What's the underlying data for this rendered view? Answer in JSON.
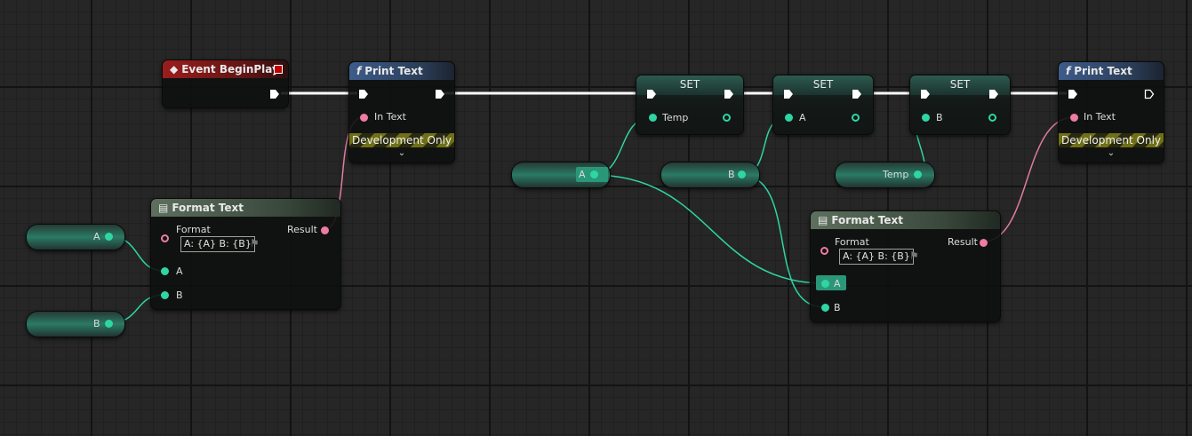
{
  "nodes": {
    "event_begin_play": {
      "title": "Event BeginPlay"
    },
    "print_text_1": {
      "title": "Print Text",
      "in_text_label": "In Text",
      "dev_only": "Development Only"
    },
    "print_text_2": {
      "title": "Print Text",
      "in_text_label": "In Text",
      "dev_only": "Development Only"
    },
    "format_text_1": {
      "title": "Format Text",
      "format_label": "Format",
      "format_value": "A: {A} B: {B}",
      "result_label": "Result",
      "a_label": "A",
      "b_label": "B"
    },
    "format_text_2": {
      "title": "Format Text",
      "format_label": "Format",
      "format_value": "A: {A} B: {B}",
      "result_label": "Result",
      "a_label": "A",
      "b_label": "B"
    },
    "set_temp": {
      "title": "SET",
      "var_label": "Temp"
    },
    "set_a": {
      "title": "SET",
      "var_label": "A"
    },
    "set_b": {
      "title": "SET",
      "var_label": "B"
    },
    "get_a_left": {
      "label": "A"
    },
    "get_b_left": {
      "label": "B"
    },
    "get_a_mid": {
      "label": "A"
    },
    "get_b_mid": {
      "label": "B"
    },
    "get_temp": {
      "label": "Temp"
    }
  },
  "colors": {
    "exec_wire": "#ffffff",
    "text_wire": "#e07ca0",
    "var_wire": "#2ed6a4"
  },
  "icons": {
    "function": "f-icon",
    "event": "diamond-icon",
    "format": "table-icon",
    "exec": "exec-arrow-icon",
    "flag": "flag-icon",
    "chevron": "chevron-down-icon"
  }
}
